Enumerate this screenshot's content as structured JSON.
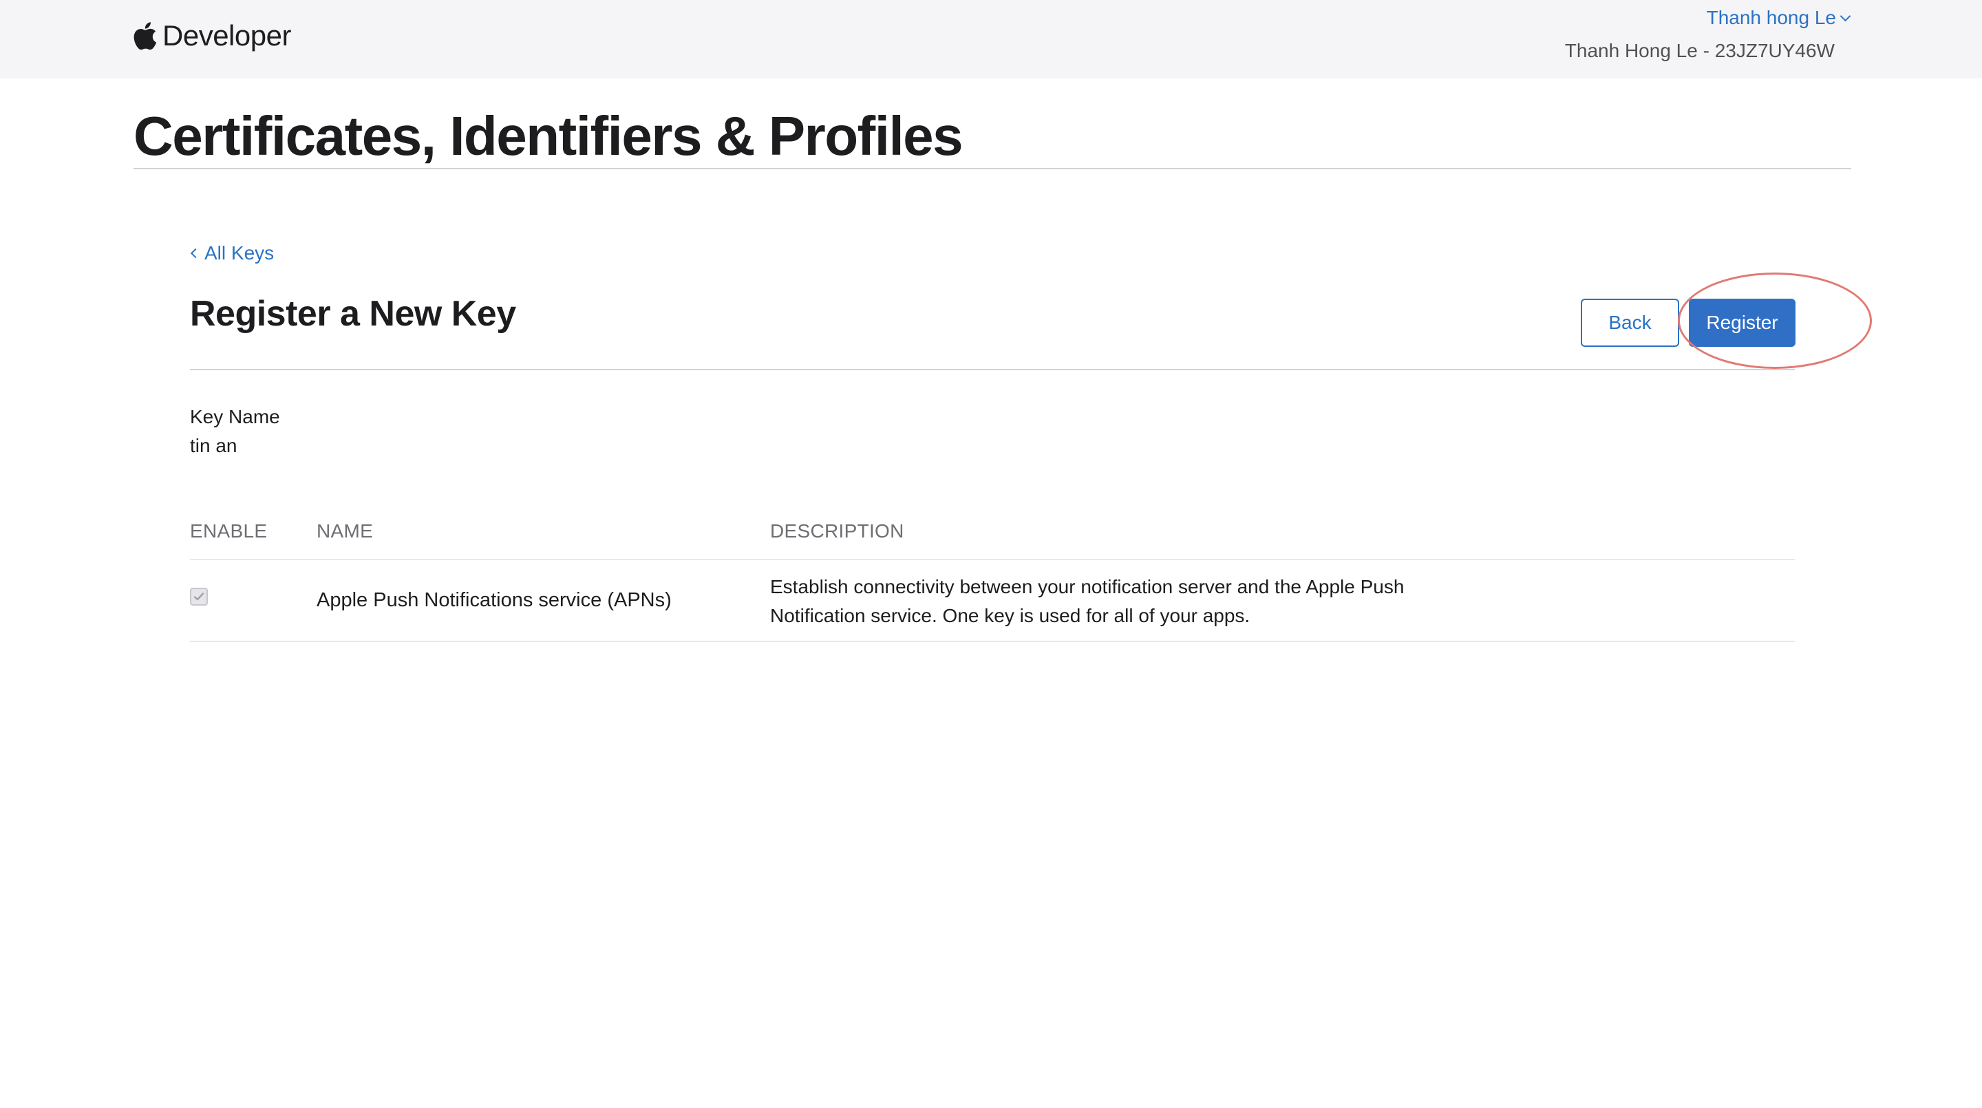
{
  "header": {
    "brand_text": "Developer",
    "account_name": "Thanh hong Le",
    "account_team": "Thanh Hong Le - 23JZ7UY46W"
  },
  "page": {
    "title": "Certificates, Identifiers & Profiles"
  },
  "register_key": {
    "back_link": "All Keys",
    "title": "Register a New Key",
    "back_button": "Back",
    "register_button": "Register",
    "key_name_label": "Key Name",
    "key_name_value": "tin an"
  },
  "services_table": {
    "columns": [
      "ENABLE",
      "NAME",
      "DESCRIPTION"
    ],
    "rows": [
      {
        "enabled": true,
        "name": "Apple Push Notifications service (APNs)",
        "description": "Establish connectivity between your notification server and the Apple Push Notification service. One key is used for all of your apps."
      }
    ]
  },
  "colors": {
    "accent": "#2b72c5",
    "primary_button": "#2f6fc6",
    "highlight_ring": "#e07a72",
    "topbar_bg": "#f5f5f7"
  },
  "icons": [
    "apple-logo-icon",
    "chevron-down-icon",
    "chevron-left-icon",
    "checkmark-icon"
  ]
}
